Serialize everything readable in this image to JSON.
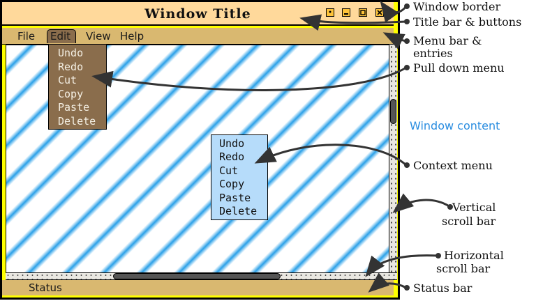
{
  "window": {
    "title": "Window Title",
    "menu": [
      "File",
      "Edit",
      "View",
      "Help"
    ],
    "status": "Status"
  },
  "pulldown_menu": [
    "Undo",
    "Redo",
    "Cut",
    "Copy",
    "Paste",
    "Delete"
  ],
  "context_menu": [
    "Undo",
    "Redo",
    "Cut",
    "Copy",
    "Paste",
    "Delete"
  ],
  "labels": {
    "window_border": "Window border",
    "title_bar": "Title bar & buttons",
    "menu_bar_1": "Menu bar &",
    "menu_bar_2": "entries",
    "pull_down": "Pull down menu",
    "window_content": "Window content",
    "context_menu": "Context menu",
    "vscroll_1": "Vertical",
    "vscroll_2": "scroll bar",
    "hscroll_1": "Horizontal",
    "hscroll_2": "scroll bar",
    "status_bar": "Status bar"
  },
  "colors": {
    "border": "#ffff00",
    "title_bar": "#ffd99b",
    "menu_bar": "#d9b870",
    "pulldown": "#8a6d4c",
    "context": "#b6dcfa",
    "stripe": "#2aa0e8"
  }
}
